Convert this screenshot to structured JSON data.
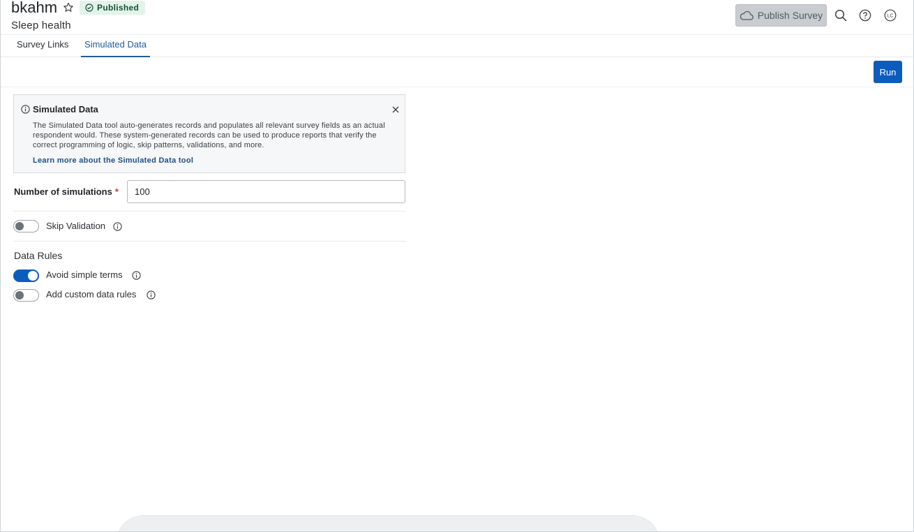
{
  "header": {
    "survey_name": "bkahm",
    "status_badge": "Published",
    "subtitle": "Sleep health",
    "publish_label": "Publish Survey",
    "avatar_initials": "LC"
  },
  "tabs": [
    {
      "label": "Survey Links",
      "active": false
    },
    {
      "label": "Simulated Data",
      "active": true
    }
  ],
  "toolbar": {
    "run_label": "Run"
  },
  "info_box": {
    "title": "Simulated Data",
    "body": "The Simulated Data tool auto-generates records and populates all relevant survey fields as an actual respondent would. These system-generated records can be used to produce reports that verify the correct programming of logic, skip patterns, validations, and more.",
    "link": "Learn more about the Simulated Data tool"
  },
  "form": {
    "simulations_label": "Number of simulations",
    "required_mark": "*",
    "simulations_value": "100",
    "skip_validation_label": "Skip Validation",
    "skip_validation_on": false,
    "data_rules_title": "Data Rules",
    "avoid_simple_terms_label": "Avoid simple terms",
    "avoid_simple_terms_on": true,
    "custom_rules_label": "Add custom data rules",
    "custom_rules_on": false
  },
  "colors": {
    "accent": "#0b5cbd",
    "badge_bg": "#e2f3ea",
    "tab_active": "#1f5c99"
  }
}
